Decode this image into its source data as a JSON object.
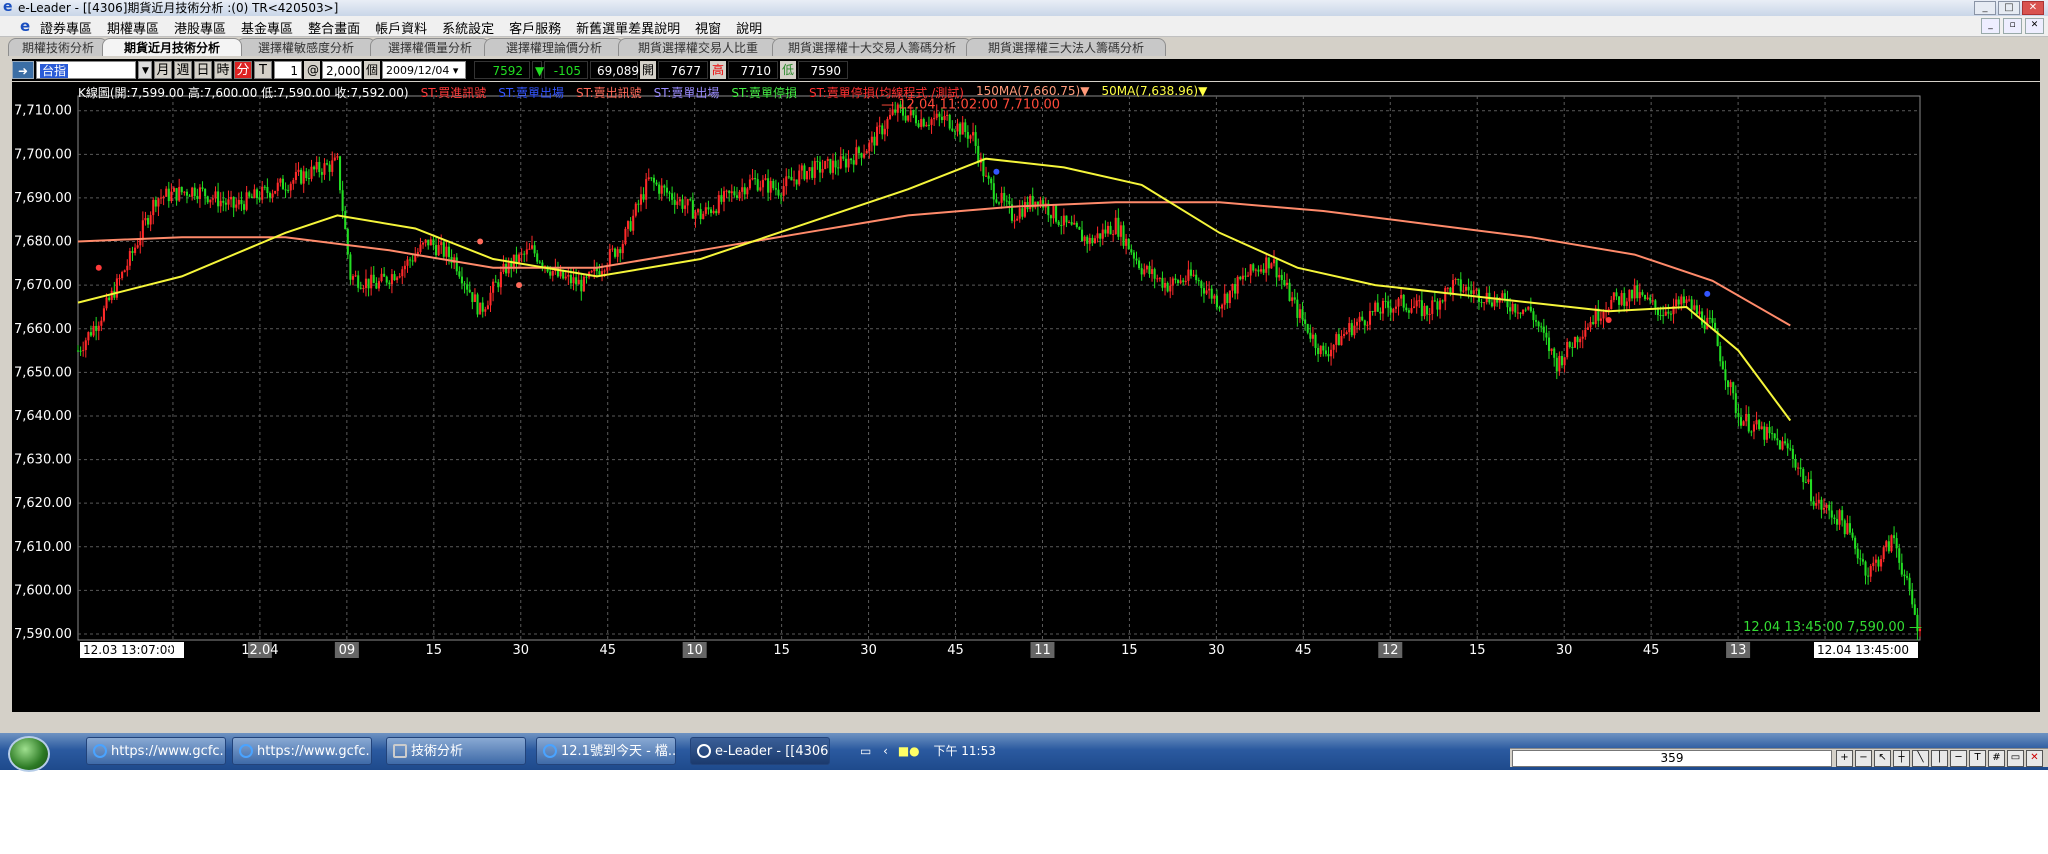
{
  "window": {
    "title": "e-Leader - [[4306]期貨近月技術分析 :(0) TR<420503>]",
    "app_icon": "e"
  },
  "menu": [
    "證券專區",
    "期權專區",
    "港股專區",
    "基金專區",
    "整合畫面",
    "帳戶資料",
    "系統設定",
    "客戶服務",
    "新舊選單差異說明",
    "視窗",
    "說明"
  ],
  "tabs": [
    {
      "label": "期權技術分析",
      "active": false
    },
    {
      "label": "期貨近月技術分析",
      "active": true
    },
    {
      "label": "選擇權敏感度分析",
      "active": false
    },
    {
      "label": "選擇權價量分析",
      "active": false
    },
    {
      "label": "選擇權理論價分析",
      "active": false
    },
    {
      "label": "期貨選擇權交易人比重",
      "active": false
    },
    {
      "label": "期貨選擇權十大交易人籌碼分析",
      "active": false
    },
    {
      "label": "期貨選擇權三大法人籌碼分析",
      "active": false
    }
  ],
  "toolbar": {
    "symbol": "台指",
    "periods": [
      "月",
      "週",
      "日",
      "時",
      "分",
      "T"
    ],
    "active_period": "分",
    "interval": "1",
    "at": "@",
    "bars": "2,000",
    "bars_unit": "個",
    "date": "2009/12/04",
    "quote": {
      "last": "7592",
      "arrow": "▼",
      "change": "-105",
      "volume": "69,089",
      "open_label": "開",
      "open": "7677",
      "high_label": "高",
      "high": "7710",
      "low_label": "低",
      "low": "7590"
    }
  },
  "legend": [
    {
      "text": "K線圖(開:7,599.00 高:7,600.00 低:7,590.00 收:7,592.00)",
      "color": "#ffffff"
    },
    {
      "text": "ST:買進訊號",
      "color": "#ff3b3b"
    },
    {
      "text": "ST:賣單出場",
      "color": "#3355ff"
    },
    {
      "text": "ST:賣出訊號",
      "color": "#ff6a5a"
    },
    {
      "text": "ST:賣單出場",
      "color": "#9a8cff"
    },
    {
      "text": "ST:賣單停損",
      "color": "#44ee44"
    },
    {
      "text": "ST:賣單停損(均線程式./測試)",
      "color": "#ff3030"
    },
    {
      "text": "150MA(7,660.75)▼",
      "color": "#ff9a7a"
    },
    {
      "text": "50MA(7,638.96)▼",
      "color": "#ffff44"
    }
  ],
  "annotations": {
    "high_marker": "— 12.04 11:02:00  7,710.00",
    "last_marker": "12.04 13:45:00  7,590.00 —",
    "cursor_time": "12.04 13:45:00",
    "start_time": "12.03 13:07:00"
  },
  "chart_data": {
    "type": "candlestick",
    "y_ticks": [
      "7,710.00",
      "7,700.00",
      "7,690.00",
      "7,680.00",
      "7,670.00",
      "7,660.00",
      "7,650.00",
      "7,640.00",
      "7,630.00",
      "7,620.00",
      "7,610.00",
      "7,600.00",
      "7,590.00"
    ],
    "ylim": [
      7590,
      7712
    ],
    "x_ticks": [
      "12.03 13:07:00",
      "30",
      "12.04",
      "09",
      "15",
      "30",
      "45",
      "10",
      "15",
      "30",
      "45",
      "11",
      "15",
      "30",
      "45",
      "12",
      "15",
      "30",
      "45",
      "13",
      "15",
      "12.04 13:45:00"
    ],
    "x_tick_highlight": [
      "12.04",
      "09",
      "10",
      "11",
      "12",
      "13"
    ],
    "price_path": [
      [
        0,
        7655
      ],
      [
        10,
        7664
      ],
      [
        20,
        7676
      ],
      [
        30,
        7690
      ],
      [
        45,
        7692
      ],
      [
        60,
        7688
      ],
      [
        75,
        7692
      ],
      [
        90,
        7696
      ],
      [
        100,
        7698
      ],
      [
        105,
        7672
      ],
      [
        115,
        7670
      ],
      [
        125,
        7674
      ],
      [
        135,
        7680
      ],
      [
        145,
        7676
      ],
      [
        155,
        7664
      ],
      [
        165,
        7674
      ],
      [
        175,
        7678
      ],
      [
        185,
        7672
      ],
      [
        195,
        7670
      ],
      [
        210,
        7680
      ],
      [
        220,
        7694
      ],
      [
        230,
        7690
      ],
      [
        240,
        7686
      ],
      [
        250,
        7690
      ],
      [
        260,
        7694
      ],
      [
        270,
        7692
      ],
      [
        280,
        7696
      ],
      [
        295,
        7698
      ],
      [
        305,
        7702
      ],
      [
        315,
        7710
      ],
      [
        325,
        7708
      ],
      [
        335,
        7708
      ],
      [
        345,
        7704
      ],
      [
        350,
        7694
      ],
      [
        360,
        7686
      ],
      [
        370,
        7690
      ],
      [
        380,
        7684
      ],
      [
        390,
        7680
      ],
      [
        400,
        7684
      ],
      [
        410,
        7674
      ],
      [
        420,
        7670
      ],
      [
        430,
        7672
      ],
      [
        440,
        7666
      ],
      [
        450,
        7672
      ],
      [
        460,
        7676
      ],
      [
        470,
        7664
      ],
      [
        480,
        7654
      ],
      [
        490,
        7660
      ],
      [
        500,
        7664
      ],
      [
        510,
        7666
      ],
      [
        520,
        7664
      ],
      [
        530,
        7670
      ],
      [
        540,
        7668
      ],
      [
        550,
        7666
      ],
      [
        560,
        7664
      ],
      [
        570,
        7652
      ],
      [
        580,
        7660
      ],
      [
        590,
        7666
      ],
      [
        600,
        7668
      ],
      [
        610,
        7664
      ],
      [
        620,
        7666
      ],
      [
        630,
        7660
      ],
      [
        640,
        7640
      ],
      [
        650,
        7636
      ],
      [
        660,
        7632
      ],
      [
        670,
        7620
      ],
      [
        680,
        7616
      ],
      [
        690,
        7604
      ],
      [
        700,
        7612
      ],
      [
        710,
        7590
      ]
    ],
    "ma150_path": [
      [
        0,
        7680
      ],
      [
        40,
        7681
      ],
      [
        80,
        7681
      ],
      [
        120,
        7678
      ],
      [
        160,
        7674
      ],
      [
        200,
        7674
      ],
      [
        240,
        7678
      ],
      [
        280,
        7682
      ],
      [
        320,
        7686
      ],
      [
        360,
        7688
      ],
      [
        400,
        7689
      ],
      [
        440,
        7689
      ],
      [
        480,
        7687
      ],
      [
        520,
        7684
      ],
      [
        560,
        7681
      ],
      [
        600,
        7677
      ],
      [
        630,
        7671
      ],
      [
        660,
        7660.75
      ]
    ],
    "ma50_path": [
      [
        0,
        7666
      ],
      [
        40,
        7672
      ],
      [
        80,
        7682
      ],
      [
        100,
        7686
      ],
      [
        130,
        7683
      ],
      [
        160,
        7676
      ],
      [
        200,
        7672
      ],
      [
        240,
        7676
      ],
      [
        280,
        7684
      ],
      [
        320,
        7692
      ],
      [
        350,
        7699
      ],
      [
        380,
        7697
      ],
      [
        410,
        7693
      ],
      [
        440,
        7682
      ],
      [
        470,
        7674
      ],
      [
        500,
        7670
      ],
      [
        530,
        7668
      ],
      [
        560,
        7666
      ],
      [
        590,
        7664
      ],
      [
        620,
        7665
      ],
      [
        640,
        7655
      ],
      [
        660,
        7638.96
      ]
    ],
    "signals": [
      {
        "x": 8,
        "y": 7674,
        "type": "buy"
      },
      {
        "x": 155,
        "y": 7680,
        "type": "sell"
      },
      {
        "x": 170,
        "y": 7670,
        "type": "sell"
      },
      {
        "x": 354,
        "y": 7696,
        "type": "exit"
      },
      {
        "x": 590,
        "y": 7662,
        "type": "buy"
      },
      {
        "x": 628,
        "y": 7668,
        "type": "exit"
      }
    ],
    "high": {
      "x": 325,
      "y": 7710
    },
    "last": {
      "x": 710,
      "y": 7590
    }
  },
  "taskbar": {
    "buttons": [
      {
        "label": "https://www.gcfc...",
        "active": false
      },
      {
        "label": "https://www.gcfc...",
        "active": false
      },
      {
        "label": "技術分析",
        "active": false
      },
      {
        "label": "12.1號到今天 - 檔...",
        "active": false
      },
      {
        "label": "e-Leader - [[4306...",
        "active": true
      }
    ],
    "clock": "下午 11:53"
  },
  "status": {
    "scroll_value": "359"
  },
  "colors": {
    "up": "#ff2a2a",
    "down": "#22dd22",
    "ma150": "#ff8a6a",
    "ma50": "#f5f53a",
    "grid": "#5a5a5a",
    "bg": "#000000"
  }
}
